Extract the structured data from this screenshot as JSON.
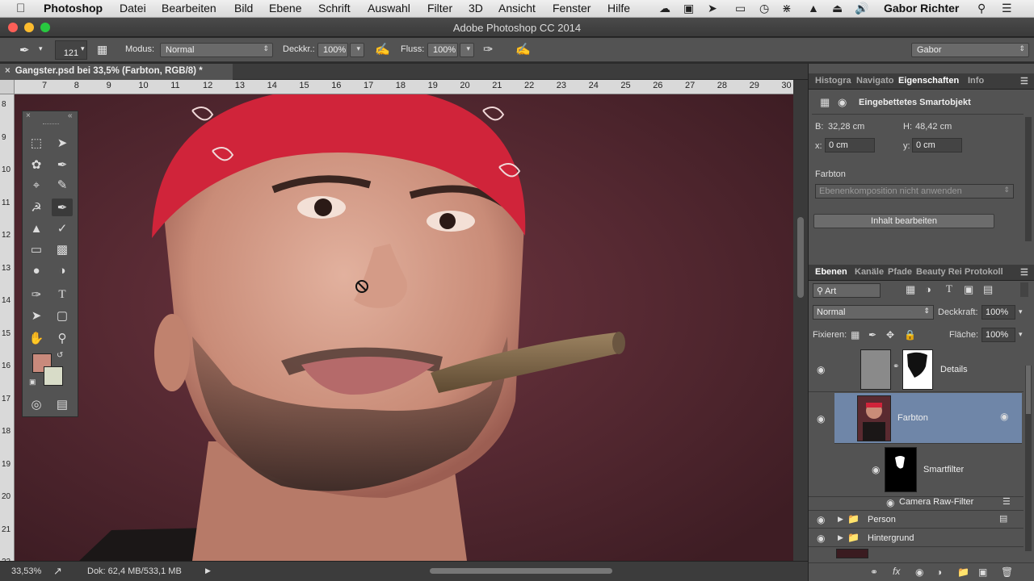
{
  "menubar": {
    "app": "Photoshop",
    "items": [
      "Datei",
      "Bearbeiten",
      "Bild",
      "Ebene",
      "Schrift",
      "Auswahl",
      "Filter",
      "3D",
      "Ansicht",
      "Fenster",
      "Hilfe"
    ],
    "user": "Gabor Richter"
  },
  "window": {
    "title": "Adobe Photoshop CC 2014"
  },
  "options": {
    "brush_size": "121",
    "mode_label": "Modus:",
    "mode_value": "Normal",
    "opacity_label": "Deckkr.:",
    "opacity_value": "100%",
    "flow_label": "Fluss:",
    "flow_value": "100%",
    "workspace": "Gabor"
  },
  "document": {
    "tab_title": "Gangster.psd bei 33,5% (Farbton, RGB/8) *",
    "ruler_h": [
      "7",
      "8",
      "9",
      "10",
      "11",
      "12",
      "13",
      "14",
      "15",
      "16",
      "17",
      "18",
      "19",
      "20",
      "21",
      "22",
      "23",
      "24",
      "25",
      "26",
      "27",
      "28",
      "29",
      "30"
    ],
    "ruler_v": [
      "8",
      "9",
      "10",
      "11",
      "12",
      "13",
      "14",
      "15",
      "16",
      "17",
      "18",
      "19",
      "20",
      "21",
      "22"
    ]
  },
  "status": {
    "zoom": "33,53%",
    "doc": "Dok: 62,4 MB/533,1 MB"
  },
  "props_panel": {
    "tabs": [
      "Histogra",
      "Navigato",
      "Eigenschaften",
      "Info"
    ],
    "heading": "Eingebettetes Smartobjekt",
    "b_label": "B:",
    "b_value": "32,28 cm",
    "h_label": "H:",
    "h_value": "48,42 cm",
    "x_label": "x:",
    "x_value": "0 cm",
    "y_label": "y:",
    "y_value": "0 cm",
    "farbton_label": "Farbton",
    "comp_value": "Ebenenkomposition nicht anwenden",
    "edit_button": "Inhalt bearbeiten"
  },
  "layers_panel": {
    "tabs": [
      "Ebenen",
      "Kanäle",
      "Pfade",
      "Beauty Rei",
      "Protokoll"
    ],
    "filter_kind": "Art",
    "blend_mode": "Normal",
    "opacity_label": "Deckkraft:",
    "opacity_value": "100%",
    "lock_label": "Fixieren:",
    "fill_label": "Fläche:",
    "fill_value": "100%",
    "layers": [
      "Details",
      "Farbton",
      "Smartfilter",
      "Camera Raw-Filter",
      "Person",
      "Hintergrund"
    ]
  },
  "colors": {
    "fg": "#c98a7c",
    "bg": "#d8dcc8",
    "selected_layer": "#6f86a8",
    "accent_red": "#d0243a"
  }
}
